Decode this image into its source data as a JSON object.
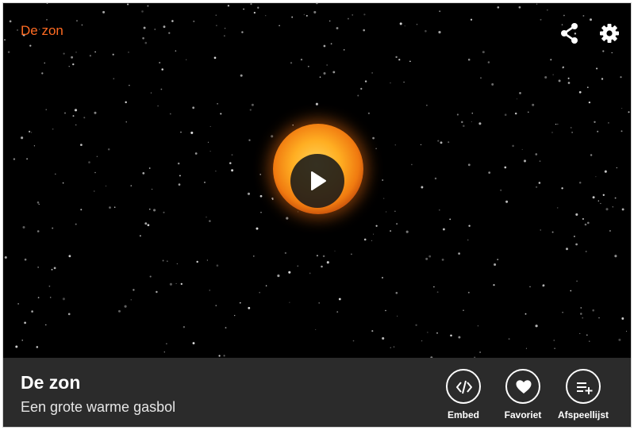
{
  "video": {
    "title": "De zon"
  },
  "info": {
    "title": "De zon",
    "subtitle": "Een grote warme gasbol"
  },
  "actions": [
    {
      "label": "Embed",
      "icon": "code-icon"
    },
    {
      "label": "Favoriet",
      "icon": "heart-icon"
    },
    {
      "label": "Afspeellijst",
      "icon": "playlist-add-icon"
    }
  ],
  "colors": {
    "accent": "#ff6b22",
    "bar": "#2b2b2b",
    "video_bg": "#000000"
  }
}
